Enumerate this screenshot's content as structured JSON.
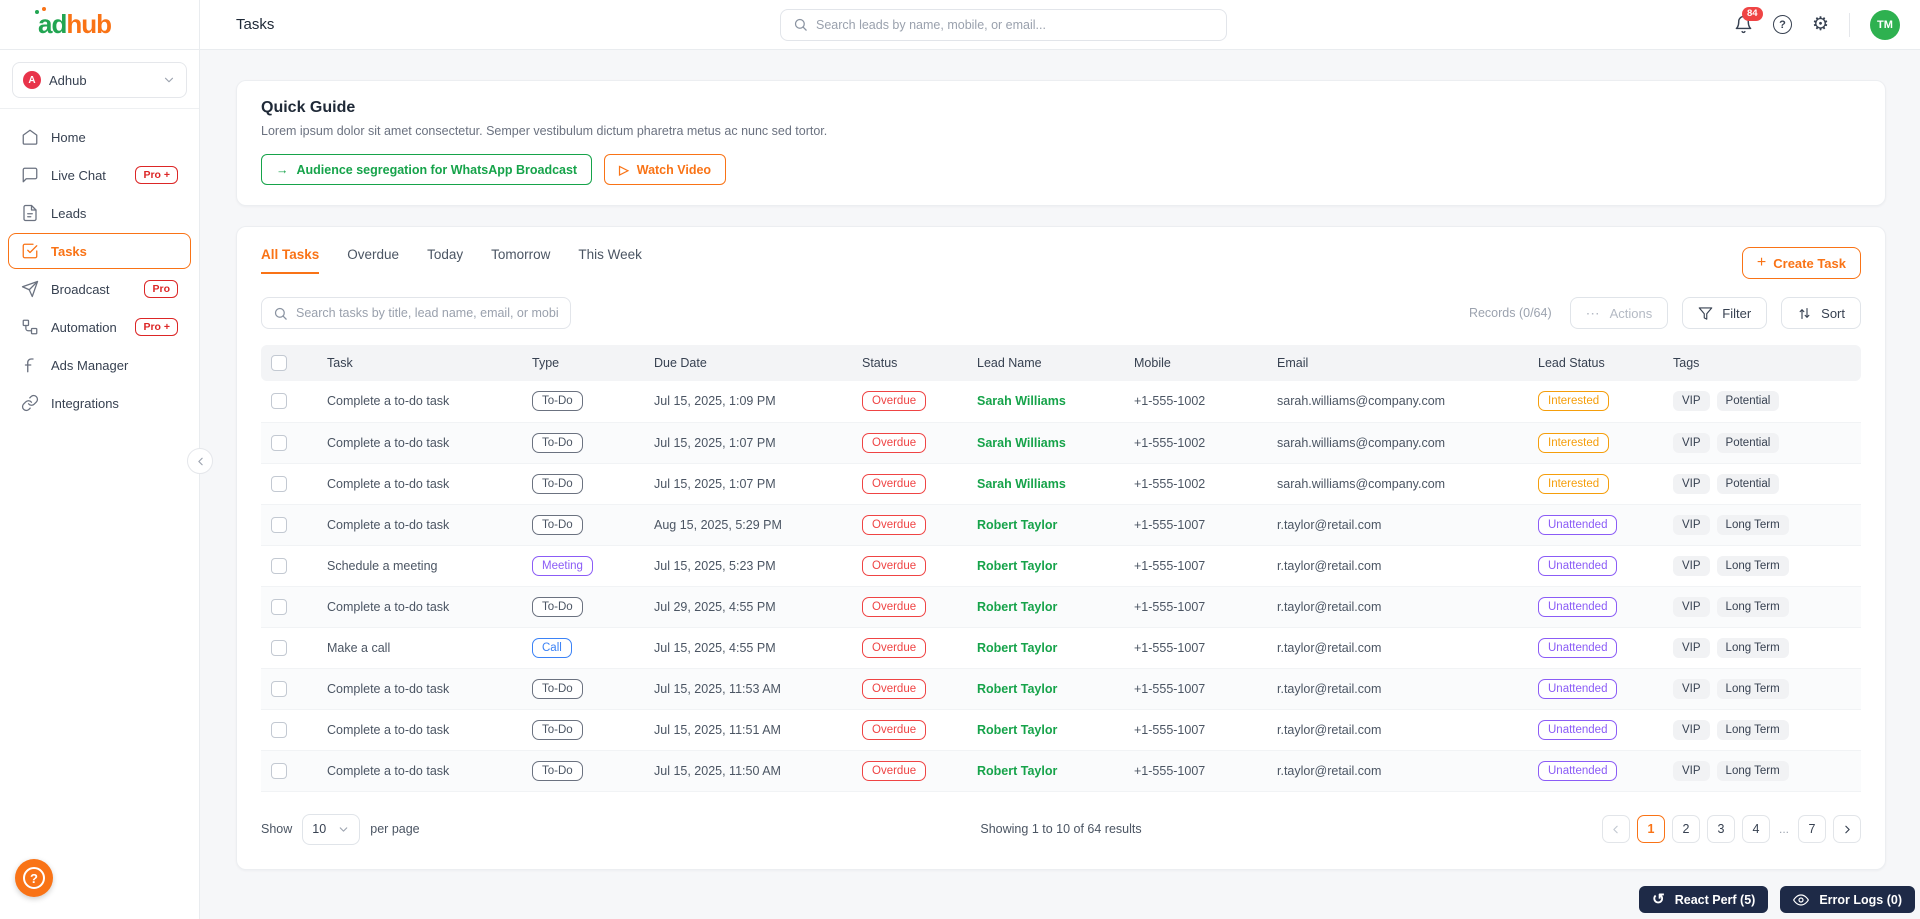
{
  "brand": {
    "name_part1": "ad",
    "name_part2": "hub",
    "workspace_name": "Adhub",
    "workspace_initial": "A"
  },
  "header": {
    "title": "Tasks",
    "search_placeholder": "Search leads by name, mobile, or email...",
    "notification_count": "84",
    "avatar_initials": "TM",
    "help_glyph": "?"
  },
  "sidebar": {
    "items": [
      {
        "label": "Home",
        "icon": "home",
        "badge": null,
        "active": false
      },
      {
        "label": "Live Chat",
        "icon": "chat",
        "badge": "Pro +",
        "active": false
      },
      {
        "label": "Leads",
        "icon": "leads",
        "badge": null,
        "active": false
      },
      {
        "label": "Tasks",
        "icon": "tasks",
        "badge": null,
        "active": true
      },
      {
        "label": "Broadcast",
        "icon": "broadcast",
        "badge": "Pro",
        "active": false
      },
      {
        "label": "Automation",
        "icon": "automation",
        "badge": "Pro +",
        "active": false
      },
      {
        "label": "Ads Manager",
        "icon": "ads",
        "badge": null,
        "active": false
      },
      {
        "label": "Integrations",
        "icon": "link",
        "badge": null,
        "active": false
      }
    ]
  },
  "quick_guide": {
    "title": "Quick Guide",
    "description": "Lorem ipsum dolor sit amet consectetur. Semper vestibulum dictum pharetra metus ac nunc sed tortor.",
    "audience_button": "Audience segregation for WhatsApp Broadcast",
    "watch_button": "Watch Video"
  },
  "tasks_panel": {
    "tabs": [
      {
        "label": "All Tasks",
        "active": true
      },
      {
        "label": "Overdue",
        "active": false
      },
      {
        "label": "Today",
        "active": false
      },
      {
        "label": "Tomorrow",
        "active": false
      },
      {
        "label": "This Week",
        "active": false
      }
    ],
    "create_button": "Create Task",
    "search_placeholder": "Search tasks by title, lead name, email, or mobile...",
    "records": "Records (0/64)",
    "actions": "Actions",
    "filter": "Filter",
    "sort": "Sort"
  },
  "table": {
    "columns": [
      "Task",
      "Type",
      "Due Date",
      "Status",
      "Lead Name",
      "Mobile",
      "Email",
      "Lead Status",
      "Tags"
    ],
    "rows": [
      {
        "task": "Complete a to-do task",
        "type": "To-Do",
        "due": "Jul 15, 2025, 1:09 PM",
        "status": "Overdue",
        "lead": "Sarah Williams",
        "mobile": "+1-555-1002",
        "email": "sarah.williams@company.com",
        "lead_status": "Interested",
        "tags": [
          "VIP",
          "Potential"
        ]
      },
      {
        "task": "Complete a to-do task",
        "type": "To-Do",
        "due": "Jul 15, 2025, 1:07 PM",
        "status": "Overdue",
        "lead": "Sarah Williams",
        "mobile": "+1-555-1002",
        "email": "sarah.williams@company.com",
        "lead_status": "Interested",
        "tags": [
          "VIP",
          "Potential"
        ]
      },
      {
        "task": "Complete a to-do task",
        "type": "To-Do",
        "due": "Jul 15, 2025, 1:07 PM",
        "status": "Overdue",
        "lead": "Sarah Williams",
        "mobile": "+1-555-1002",
        "email": "sarah.williams@company.com",
        "lead_status": "Interested",
        "tags": [
          "VIP",
          "Potential"
        ]
      },
      {
        "task": "Complete a to-do task",
        "type": "To-Do",
        "due": "Aug 15, 2025, 5:29 PM",
        "status": "Overdue",
        "lead": "Robert Taylor",
        "mobile": "+1-555-1007",
        "email": "r.taylor@retail.com",
        "lead_status": "Unattended",
        "tags": [
          "VIP",
          "Long Term"
        ]
      },
      {
        "task": "Schedule a meeting",
        "type": "Meeting",
        "due": "Jul 15, 2025, 5:23 PM",
        "status": "Overdue",
        "lead": "Robert Taylor",
        "mobile": "+1-555-1007",
        "email": "r.taylor@retail.com",
        "lead_status": "Unattended",
        "tags": [
          "VIP",
          "Long Term"
        ]
      },
      {
        "task": "Complete a to-do task",
        "type": "To-Do",
        "due": "Jul 29, 2025, 4:55 PM",
        "status": "Overdue",
        "lead": "Robert Taylor",
        "mobile": "+1-555-1007",
        "email": "r.taylor@retail.com",
        "lead_status": "Unattended",
        "tags": [
          "VIP",
          "Long Term"
        ]
      },
      {
        "task": "Make a call",
        "type": "Call",
        "due": "Jul 15, 2025, 4:55 PM",
        "status": "Overdue",
        "lead": "Robert Taylor",
        "mobile": "+1-555-1007",
        "email": "r.taylor@retail.com",
        "lead_status": "Unattended",
        "tags": [
          "VIP",
          "Long Term"
        ]
      },
      {
        "task": "Complete a to-do task",
        "type": "To-Do",
        "due": "Jul 15, 2025, 11:53 AM",
        "status": "Overdue",
        "lead": "Robert Taylor",
        "mobile": "+1-555-1007",
        "email": "r.taylor@retail.com",
        "lead_status": "Unattended",
        "tags": [
          "VIP",
          "Long Term"
        ]
      },
      {
        "task": "Complete a to-do task",
        "type": "To-Do",
        "due": "Jul 15, 2025, 11:51 AM",
        "status": "Overdue",
        "lead": "Robert Taylor",
        "mobile": "+1-555-1007",
        "email": "r.taylor@retail.com",
        "lead_status": "Unattended",
        "tags": [
          "VIP",
          "Long Term"
        ]
      },
      {
        "task": "Complete a to-do task",
        "type": "To-Do",
        "due": "Jul 15, 2025, 11:50 AM",
        "status": "Overdue",
        "lead": "Robert Taylor",
        "mobile": "+1-555-1007",
        "email": "r.taylor@retail.com",
        "lead_status": "Unattended",
        "tags": [
          "VIP",
          "Long Term"
        ]
      }
    ]
  },
  "chip_colors": {
    "To-Do": {
      "border": "#6b7280",
      "text": "#4b5563"
    },
    "Meeting": {
      "border": "#8b5cf6",
      "text": "#8b5cf6"
    },
    "Call": {
      "border": "#3b82f6",
      "text": "#3b82f6"
    },
    "Overdue": {
      "border": "#ef4444",
      "text": "#ef4444"
    },
    "Interested": {
      "border": "#f59e0b",
      "text": "#f59e0b"
    },
    "Unattended": {
      "border": "#8b5cf6",
      "text": "#8b5cf6"
    }
  },
  "pagination": {
    "show_label": "Show",
    "page_size": "10",
    "per_page_label": "per page",
    "summary": "Showing 1 to 10 of 64 results",
    "pages": [
      "1",
      "2",
      "3",
      "4",
      "...",
      "7"
    ],
    "active_page": "1"
  },
  "overlay": {
    "react_perf": "React Perf (5)",
    "error_logs": "Error Logs (0)"
  },
  "colors": {
    "accent_orange": "#f97316",
    "brand_green": "#22a552",
    "lead_green": "#16a34a",
    "badge_red": "#dc2626",
    "dark_pill": "#1e2a47",
    "avatar_green": "#2eb150",
    "notification_red": "#ef4444"
  }
}
